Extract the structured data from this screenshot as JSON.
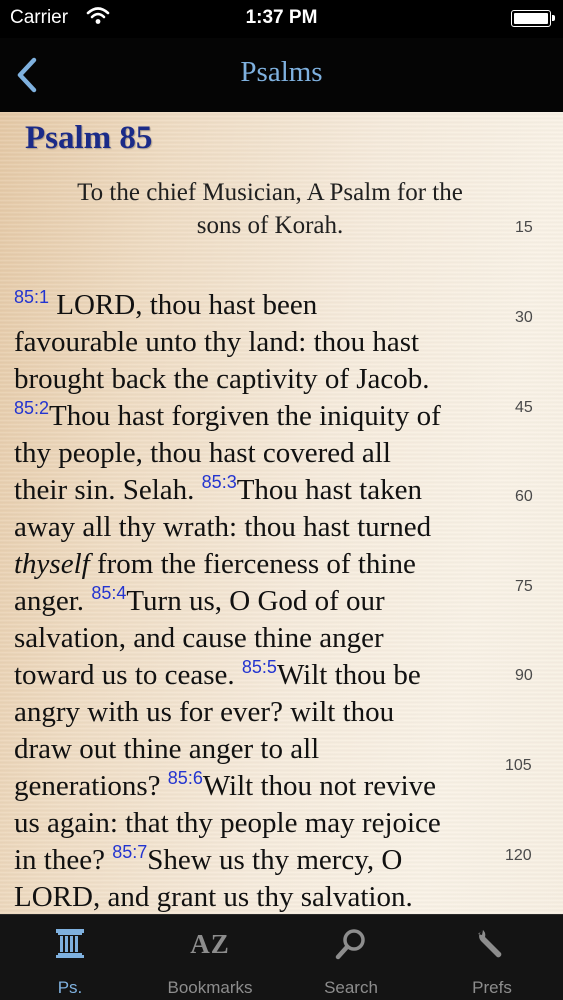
{
  "status_bar": {
    "carrier": "Carrier",
    "time": "1:37 PM"
  },
  "nav": {
    "title": "Psalms"
  },
  "content": {
    "psalm_title": "Psalm 85",
    "superscription_line1": "To the chief Musician, A Psalm for the",
    "superscription_line2": "sons of Korah.",
    "line_numbers": [
      "15",
      "30",
      "45",
      "60",
      "75",
      "90",
      "105",
      "120"
    ],
    "verses": {
      "v1_num": "85:1",
      "v1_a": " LORD, thou hast been",
      "v1_b": "favourable unto thy land: thou hast",
      "v1_c": "brought back the captivity of Jacob.",
      "v2_num": "85:2",
      "v2_a": "Thou hast forgiven the iniquity of",
      "v2_b": "thy people, thou hast covered all",
      "v2_c": "their sin. Selah. ",
      "v3_num": "85:3",
      "v3_a": "Thou hast taken",
      "v3_b": "away all thy wrath: thou hast turned",
      "v3_ital": "thyself",
      "v3_c": " from the fierceness of thine",
      "v3_d": "anger. ",
      "v4_num": "85:4",
      "v4_a": "Turn us, O God of our",
      "v4_b": "salvation, and cause thine anger",
      "v4_c": "toward us to cease. ",
      "v5_num": "85:5",
      "v5_a": "Wilt thou be",
      "v5_b": "angry with us for ever? wilt thou",
      "v5_c": "draw out thine anger to all",
      "v5_d": "generations? ",
      "v6_num": "85:6",
      "v6_a": "Wilt thou not revive",
      "v6_b": "us again: that thy people may rejoice",
      "v6_c": "in thee? ",
      "v7_num": "85:7",
      "v7_a": "Shew us thy mercy, O",
      "v7_b": "LORD, and grant us thy salvation."
    }
  },
  "tabs": [
    {
      "label": "Ps.",
      "icon": "column-icon",
      "active": true
    },
    {
      "label": "Bookmarks",
      "icon": "az-icon",
      "icon_text": "AZ"
    },
    {
      "label": "Search",
      "icon": "magnifier-icon"
    },
    {
      "label": "Prefs",
      "icon": "wrench-icon"
    }
  ],
  "colors": {
    "nav_title": "#7fb1df",
    "psalm_title": "#1b2b88",
    "verse_number": "#2334d0",
    "active_tab": "#7fb1df",
    "inactive_tab": "#8d8d8d"
  }
}
